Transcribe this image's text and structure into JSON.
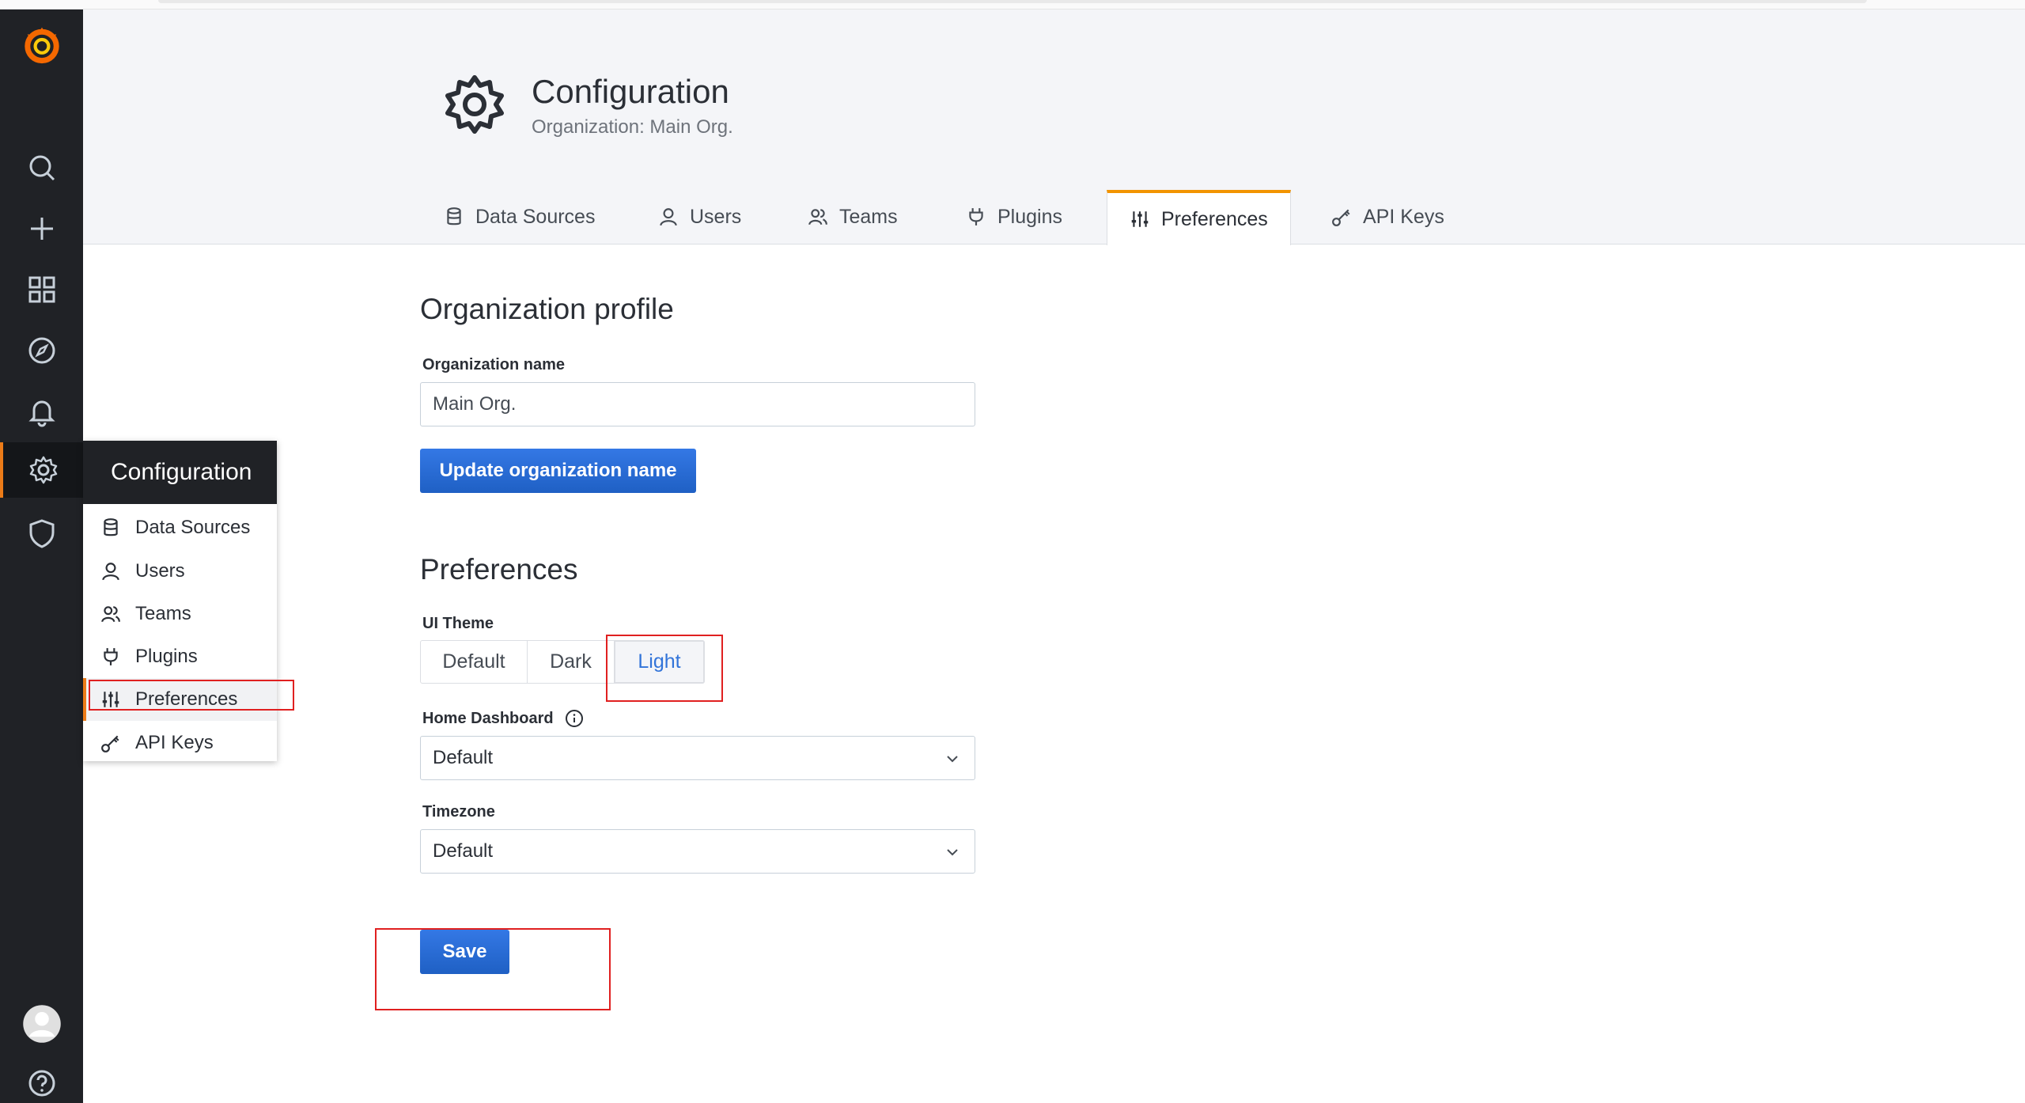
{
  "nav": {
    "icons": [
      "grafana-logo-icon",
      "search-icon",
      "plus-icon",
      "dashboards-icon",
      "explore-icon",
      "alerting-icon",
      "gear-icon",
      "shield-icon",
      "avatar",
      "help-icon"
    ]
  },
  "flyout": {
    "title": "Configuration",
    "items": [
      {
        "label": "Data Sources",
        "icon": "database-icon"
      },
      {
        "label": "Users",
        "icon": "user-icon"
      },
      {
        "label": "Teams",
        "icon": "users-icon"
      },
      {
        "label": "Plugins",
        "icon": "plug-icon"
      },
      {
        "label": "Preferences",
        "icon": "sliders-icon"
      },
      {
        "label": "API Keys",
        "icon": "key-icon"
      }
    ]
  },
  "header": {
    "title": "Configuration",
    "subtitle": "Organization: Main Org.",
    "tabs": [
      {
        "label": "Data Sources",
        "icon": "database-icon"
      },
      {
        "label": "Users",
        "icon": "user-icon"
      },
      {
        "label": "Teams",
        "icon": "users-icon"
      },
      {
        "label": "Plugins",
        "icon": "plug-icon"
      },
      {
        "label": "Preferences",
        "icon": "sliders-icon",
        "active": true
      },
      {
        "label": "API Keys",
        "icon": "key-icon"
      }
    ]
  },
  "org_profile": {
    "heading": "Organization profile",
    "name_label": "Organization name",
    "name_value": "Main Org.",
    "update_button": "Update organization name"
  },
  "preferences": {
    "heading": "Preferences",
    "theme_label": "UI Theme",
    "theme_options": [
      "Default",
      "Dark",
      "Light"
    ],
    "theme_selected": "Light",
    "home_dashboard_label": "Home Dashboard",
    "home_dashboard_value": "Default",
    "timezone_label": "Timezone",
    "timezone_value": "Default",
    "save_button": "Save"
  },
  "colors": {
    "sidebar_bg": "#202226",
    "accent_orange": "#eb7b18",
    "primary_blue": "#1f60c4",
    "selected_blue": "#3274d9",
    "annotation_red": "#e02020"
  }
}
